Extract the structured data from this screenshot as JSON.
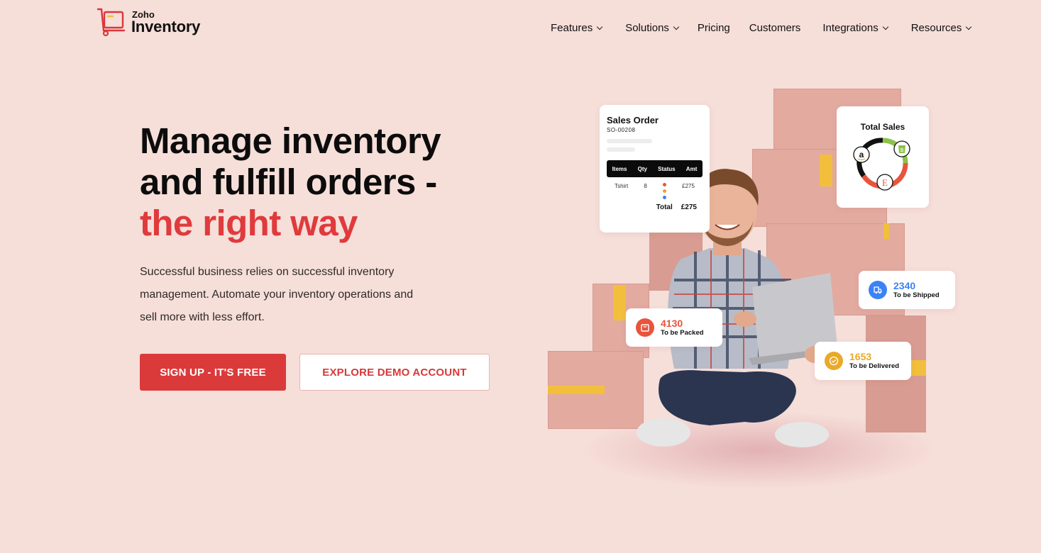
{
  "brand": {
    "logo_top": "Zoho",
    "logo_bottom": "Inventory",
    "accent_color": "#db3a3b",
    "background_color": "#f6ded9"
  },
  "nav": {
    "items": [
      {
        "label": "Features",
        "has_dropdown": true
      },
      {
        "label": "Solutions",
        "has_dropdown": true
      },
      {
        "label": "Pricing",
        "has_dropdown": false
      },
      {
        "label": "Customers",
        "has_dropdown": false
      },
      {
        "label": "Integrations",
        "has_dropdown": true
      },
      {
        "label": "Resources",
        "has_dropdown": true
      }
    ]
  },
  "hero": {
    "title_line1": "Manage inventory",
    "title_line2": "and fulfill orders -",
    "title_accent": "the right way",
    "description": "Successful business relies on successful inventory management. Automate your inventory operations and sell more with less effort.",
    "primary_button": "SIGN UP - IT'S FREE",
    "secondary_button": "EXPLORE DEMO ACCOUNT"
  },
  "illustration": {
    "sales_order": {
      "title": "Sales Order",
      "number": "SO-00208",
      "columns": [
        "Items",
        "Qty",
        "Status",
        "Amt"
      ],
      "row": {
        "item": "Tshirt",
        "qty": "8",
        "amount": "£275"
      },
      "status_colors": [
        "#e8543c",
        "#f0a030",
        "#3b82f6"
      ],
      "total_label": "Total",
      "total_value": "£275"
    },
    "total_sales": {
      "title": "Total Sales",
      "channels": [
        {
          "name": "Amazon",
          "icon": "a",
          "color": "#111111"
        },
        {
          "name": "Shopify",
          "icon": "S",
          "color": "#8bc34a"
        },
        {
          "name": "Etsy",
          "icon": "E",
          "color": "#e8543c"
        }
      ]
    },
    "stats": [
      {
        "value": "4130",
        "label": "To be Packed",
        "color": "#e8543c",
        "icon": "package-icon"
      },
      {
        "value": "2340",
        "label": "To be Shipped",
        "color": "#3b82f6",
        "icon": "truck-icon"
      },
      {
        "value": "1653",
        "label": "To be Delivered",
        "color": "#e9a92a",
        "icon": "check-circle-icon"
      }
    ]
  }
}
